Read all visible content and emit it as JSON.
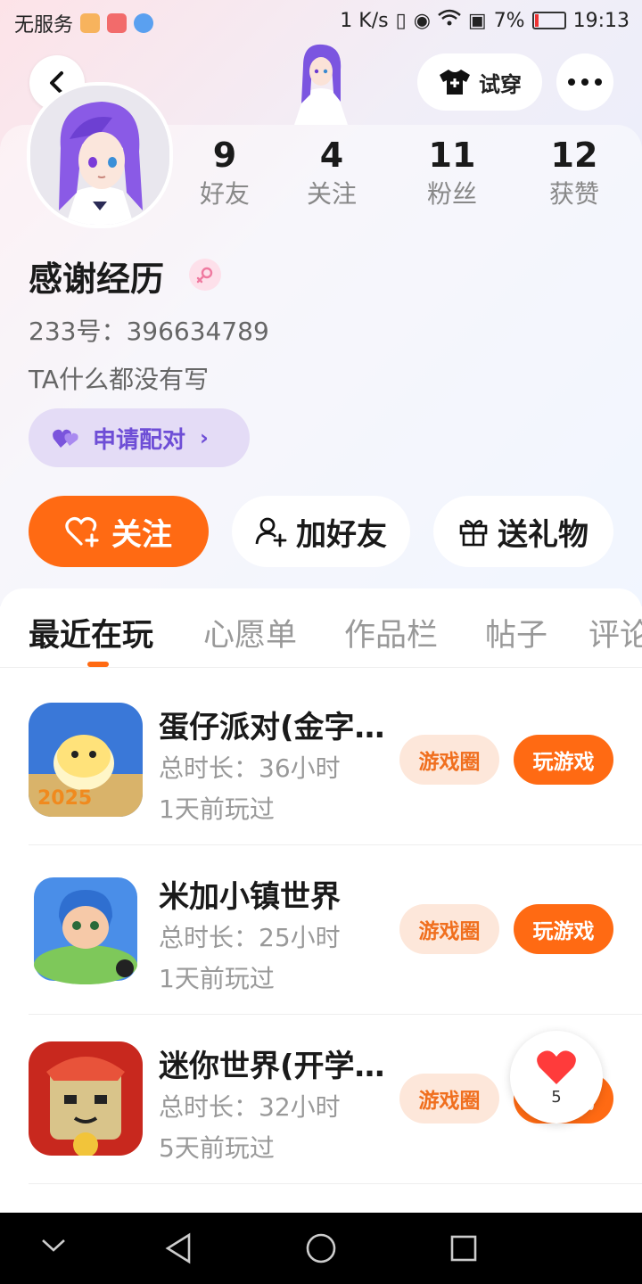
{
  "status_bar": {
    "carrier": "无服务",
    "net_speed": "1 K/s",
    "battery": "7%",
    "time": "19:13"
  },
  "header": {
    "tryon_label": "试穿"
  },
  "profile": {
    "name": "感谢经历",
    "uid": "233号：396634789",
    "bio": "TA什么都没有写",
    "pair_label": "申请配对",
    "stats": [
      {
        "num": "9",
        "label": "好友"
      },
      {
        "num": "4",
        "label": "关注"
      },
      {
        "num": "11",
        "label": "粉丝"
      },
      {
        "num": "12",
        "label": "获赞"
      }
    ]
  },
  "actions": {
    "follow": "关注",
    "add_friend": "加好友",
    "gift": "送礼物"
  },
  "tabs": [
    "最近在玩",
    "心愿单",
    "作品栏",
    "帖子",
    "评论"
  ],
  "games": [
    {
      "name": "蛋仔派对(金字…",
      "duration": "总时长：36小时",
      "last_played": "1天前玩过",
      "circle": "游戏圈",
      "play": "玩游戏"
    },
    {
      "name": "米加小镇世界",
      "duration": "总时长：25小时",
      "last_played": "1天前玩过",
      "circle": "游戏圈",
      "play": "玩游戏"
    },
    {
      "name": "迷你世界(开学…",
      "duration": "总时长：32小时",
      "last_played": "5天前玩过",
      "circle": "游戏圈",
      "play": "玩游戏"
    }
  ],
  "like_float": {
    "count": "5"
  },
  "colors": {
    "accent": "#ff6a13",
    "pair_bg": "#e4dcf6",
    "pair_text": "#6e4ed6"
  }
}
